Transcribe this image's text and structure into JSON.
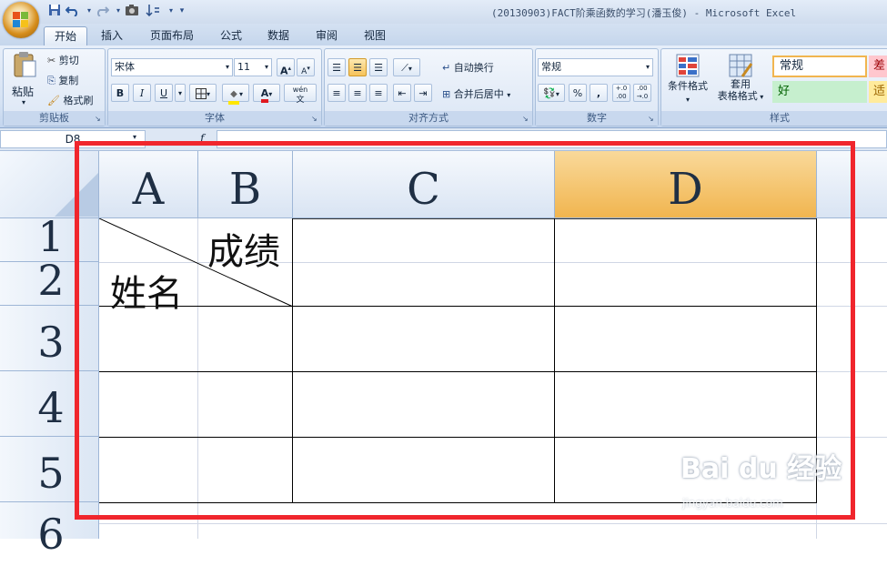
{
  "window": {
    "title": "(20130903)FACT阶乘函数的学习(潘玉俊) - Microsoft Excel"
  },
  "quick_access": {
    "icons": [
      "save-icon",
      "undo-icon",
      "redo-icon",
      "camera-icon",
      "sort-icon",
      "customize-qat-icon"
    ]
  },
  "tabs": [
    {
      "label": "开始",
      "active": true
    },
    {
      "label": "插入",
      "active": false
    },
    {
      "label": "页面布局",
      "active": false
    },
    {
      "label": "公式",
      "active": false
    },
    {
      "label": "数据",
      "active": false
    },
    {
      "label": "审阅",
      "active": false
    },
    {
      "label": "视图",
      "active": false
    }
  ],
  "ribbon": {
    "clipboard": {
      "label": "剪贴板",
      "paste": "粘贴",
      "cut": "剪切",
      "copy": "复制",
      "format_painter": "格式刷"
    },
    "font": {
      "label": "字体",
      "font_name": "宋体",
      "font_size": "11",
      "grow": "A",
      "shrink": "A",
      "bold": "B",
      "italic": "I",
      "underline": "U",
      "font_color_letter": "A",
      "phonetic": "wén",
      "phonetic_char": "文"
    },
    "alignment": {
      "label": "对齐方式",
      "wrap_text": "自动换行",
      "merge_center": "合并后居中"
    },
    "number": {
      "label": "数字",
      "format": "常规",
      "percent": "%",
      "comma": ",",
      "increase_decimal": "+.0 .00",
      "decrease_decimal": ".00 →.0"
    },
    "styles": {
      "label": "样式",
      "conditional_formatting": "条件格式",
      "format_as_table_line1": "套用",
      "format_as_table_line2": "表格格式",
      "style_normal": "常规",
      "style_bad": "差",
      "style_good": "好",
      "style_neutral": "适"
    }
  },
  "formula_bar": {
    "name_box": "D8",
    "fx": "f",
    "value": ""
  },
  "sheet": {
    "columns": [
      "A",
      "B",
      "C",
      "D"
    ],
    "selected_column": "D",
    "rows": [
      "1",
      "2",
      "3",
      "4",
      "5",
      "6"
    ],
    "header_cell": {
      "top_right": "成绩",
      "bottom_left": "姓名"
    }
  },
  "watermark": {
    "brand": "Bai du 经验",
    "site": "jingyan.baidu.com"
  },
  "colors": {
    "highlight_frame": "#f0262d",
    "selected_column_header": "#f1b54f"
  }
}
